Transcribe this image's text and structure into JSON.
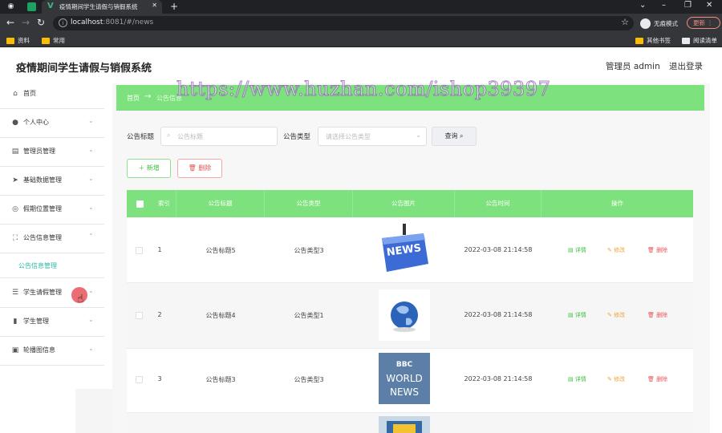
{
  "browser": {
    "tab_title": "疫情期间学生请假与销假系统",
    "url_host": "localhost",
    "url_rest": ":8081/#/news",
    "incognito_label": "无痕模式",
    "update_label": "更新",
    "bookmarks": [
      "资料",
      "常用"
    ],
    "bookmarks_right": [
      "其他书签",
      "阅读清单"
    ]
  },
  "app": {
    "title": "疫情期间学生请假与销假系统",
    "user_label": "管理员 admin",
    "logout_label": "退出登录"
  },
  "sidebar": {
    "items": [
      {
        "label": "首页",
        "icon": "home-icon"
      },
      {
        "label": "个人中心",
        "icon": "user-icon"
      },
      {
        "label": "管理员管理",
        "icon": "admin-icon"
      },
      {
        "label": "基础数据管理",
        "icon": "send-icon"
      },
      {
        "label": "假期位置管理",
        "icon": "location-icon"
      },
      {
        "label": "公告信息管理",
        "icon": "fullscreen-icon"
      },
      {
        "label": "学生请假管理",
        "icon": "sliders-icon"
      },
      {
        "label": "学生管理",
        "icon": "chart-icon"
      },
      {
        "label": "轮播图信息",
        "icon": "film-icon"
      }
    ],
    "sub_item": "公告信息管理"
  },
  "breadcrumb": {
    "home": "首页",
    "current": "公告信息"
  },
  "watermark": "https://www.huzhan.com/ishop39397",
  "search": {
    "title_label": "公告标题",
    "title_placeholder": "公告标题",
    "type_label": "公告类型",
    "type_placeholder": "请选择公告类型",
    "query_button": "查询"
  },
  "actions": {
    "add": "新增",
    "delete": "删除"
  },
  "table": {
    "columns": [
      "索引",
      "公告标题",
      "公告类型",
      "公告图片",
      "公告时间",
      "操作"
    ],
    "rows": [
      {
        "index": "1",
        "title": "公告标题5",
        "type": "公告类型3",
        "image": "news-key",
        "time": "2022-03-08 21:14:58"
      },
      {
        "index": "2",
        "title": "公告标题4",
        "type": "公告类型1",
        "image": "globe",
        "time": "2022-03-08 21:14:58"
      },
      {
        "index": "3",
        "title": "公告标题3",
        "type": "公告类型3",
        "image": "bbc-world-news",
        "time": "2022-03-08 21:14:58"
      }
    ],
    "op_labels": {
      "detail": "详情",
      "edit": "修改",
      "remove": "删除"
    },
    "bbc_text": [
      "BBC",
      "WORLD",
      "NEWS"
    ],
    "news_key_text": "NEWS"
  },
  "colors": {
    "accent_green": "#7de27d",
    "active_submenu": "#2cb8a4",
    "edit_orange": "#f0a43c",
    "delete_red": "#e45656"
  }
}
